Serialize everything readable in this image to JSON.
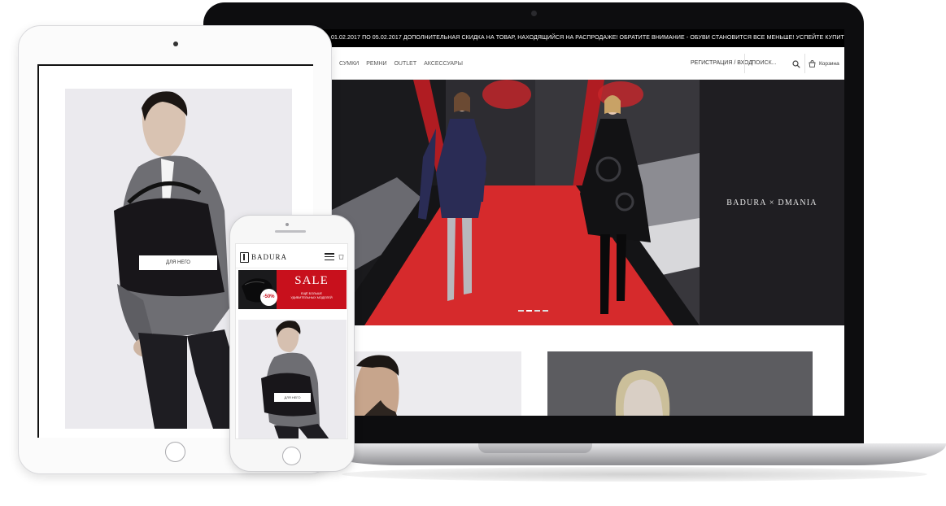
{
  "desktop": {
    "promo_text": "01.02.2017 ПО 05.02.2017 ДОПОЛНИТЕЛЬНАЯ СКИДКА НА ТОВАР, НАХОДЯЩИЙСЯ НА РАСПРОДАЖЕ! ОБРАТИТЕ ВНИМАНИЕ - ОБУВИ СТАНОВИТСЯ ВСЕ МЕНЬШЕ! УСПЕЙТЕ КУПИТЬ СВОЙ РАЗМЕР!",
    "nav": [
      "СУМКИ",
      "РЕМНИ",
      "OUTLET",
      "АКСЕССУАРЫ"
    ],
    "login": "РЕГИСТРАЦИЯ / ВХОД",
    "search_placeholder": "ПОИСК...",
    "cart": "Корзина",
    "hero_brand": "BADURA × DMANIA",
    "slider_dots": 4,
    "active_dot": 1
  },
  "tablet": {
    "button": "ДЛЯ НЕГО"
  },
  "phone": {
    "logo": "BADURA",
    "sale_title": "SALE",
    "sale_subtitle": "ЕЩЁ БОЛЬШЕ\nУДИВИТЕЛЬНЫХ МОДЕЛЕЙ",
    "sale_badge": "-50%",
    "button": "ДЛЯ НЕГО"
  },
  "colors": {
    "accent_red": "#c8101c",
    "runway_red": "#d62a2c",
    "dark_panel": "#1f1e22",
    "device_black": "#0d0d0f"
  },
  "icons": [
    "search-icon",
    "cart-icon",
    "menu-icon",
    "bag-icon"
  ]
}
